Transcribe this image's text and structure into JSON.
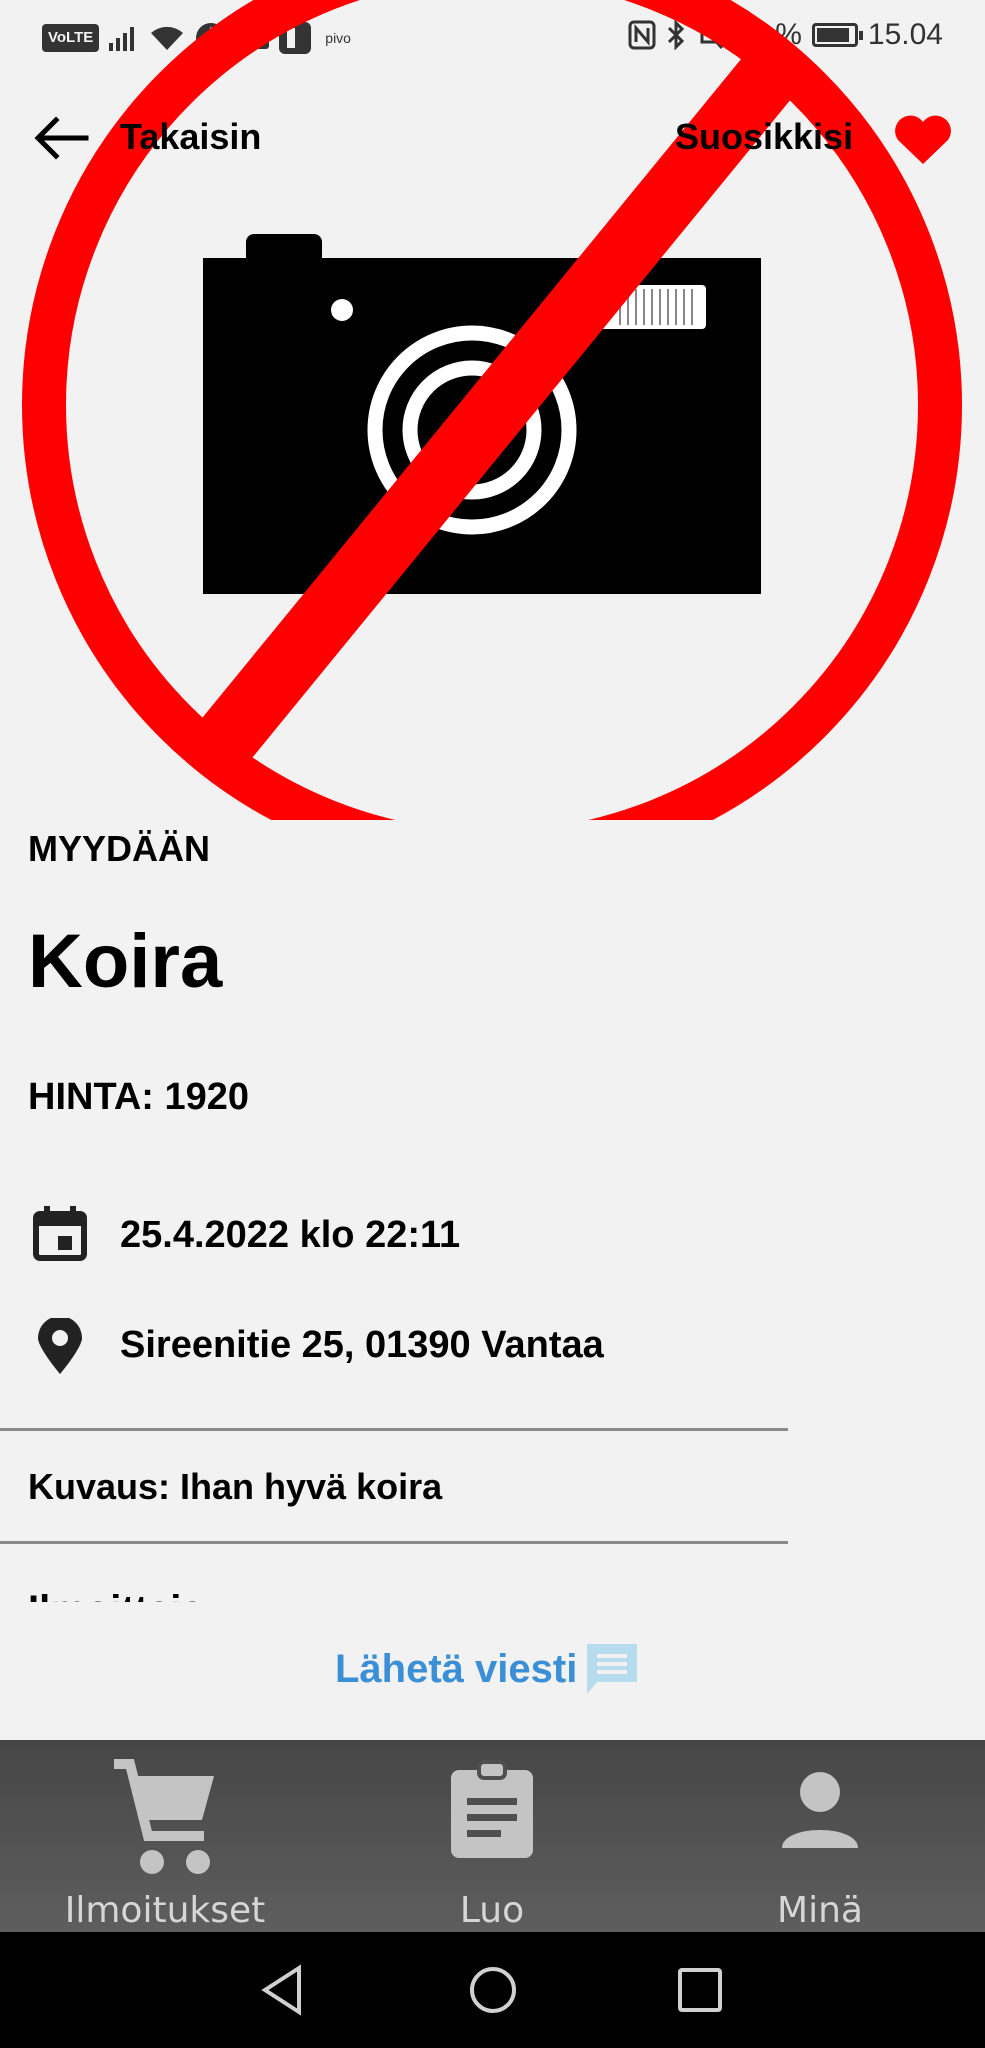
{
  "status_bar": {
    "volte": "VoLTE",
    "pivo": "pivo",
    "battery": "87 %",
    "time": "15.04"
  },
  "header": {
    "back_label": "Takaisin",
    "favorites_label": "Suosikkisi"
  },
  "listing": {
    "type": "MYYDÄÄN",
    "title": "Koira",
    "price": "HINTA: 1920",
    "date": "25.4.2022 klo 22:11",
    "location": "Sireenitie 25, 01390 Vantaa",
    "description": "Kuvaus: Ihan hyvä koira",
    "seller_label": "Ilmoittaja:"
  },
  "actions": {
    "send_message": "Lähetä viesti"
  },
  "bottom_nav": {
    "items": [
      {
        "label": "Ilmoitukset",
        "icon": "cart-icon"
      },
      {
        "label": "Luo",
        "icon": "clipboard-icon"
      },
      {
        "label": "Minä",
        "icon": "person-icon"
      }
    ]
  },
  "colors": {
    "accent_red": "#ff0000",
    "link_blue": "#3a8fd6",
    "nav_bg": "#4f4f4f"
  }
}
